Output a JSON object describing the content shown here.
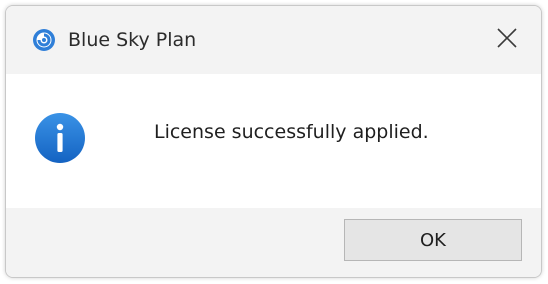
{
  "window": {
    "title": "Blue Sky Plan",
    "app_icon": "blue-sky-plan-logo-icon",
    "close_icon": "close-icon"
  },
  "message": {
    "icon": "info-icon",
    "text": "License successfully applied."
  },
  "buttons": {
    "ok_label": "OK"
  },
  "colors": {
    "info_blue": "#1a73d1",
    "logo_blue": "#2f7fd8",
    "body_bg": "#ffffff",
    "chrome_bg": "#f3f3f3"
  }
}
